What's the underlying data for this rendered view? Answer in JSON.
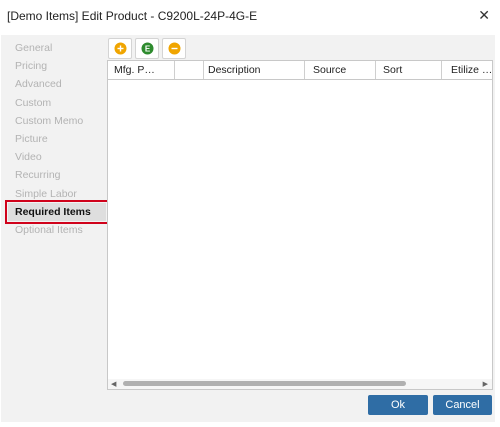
{
  "dialog": {
    "title": "[Demo Items] Edit Product - C9200L-24P-4G-E",
    "close_glyph": "✕"
  },
  "sidebar": {
    "items": [
      {
        "label": "General",
        "active": false
      },
      {
        "label": "Pricing",
        "active": false
      },
      {
        "label": "Advanced",
        "active": false
      },
      {
        "label": "Custom",
        "active": false
      },
      {
        "label": "Custom Memo",
        "active": false
      },
      {
        "label": "Picture",
        "active": false
      },
      {
        "label": "Video",
        "active": false
      },
      {
        "label": "Recurring",
        "active": false
      },
      {
        "label": "Simple Labor",
        "active": false
      },
      {
        "label": "Required Items",
        "active": true
      },
      {
        "label": "Optional Items",
        "active": false
      }
    ]
  },
  "toolbar": {
    "buttons": [
      {
        "icon": "add-icon",
        "color": "#f0a500"
      },
      {
        "icon": "edit-icon",
        "color": "#2e8b2e",
        "glyph": "E"
      },
      {
        "icon": "remove-icon",
        "color": "#f0a500"
      }
    ]
  },
  "grid": {
    "columns": [
      "Mfg. P…",
      "",
      "Description",
      "Source",
      "Sort",
      "Etilize …"
    ],
    "rows": []
  },
  "scrollbar": {
    "left_arrow": "◀",
    "right_arrow": "▶"
  },
  "footer": {
    "ok_label": "Ok",
    "cancel_label": "Cancel"
  },
  "colors": {
    "accent": "#2f6da5",
    "highlight": "#d0021b"
  }
}
